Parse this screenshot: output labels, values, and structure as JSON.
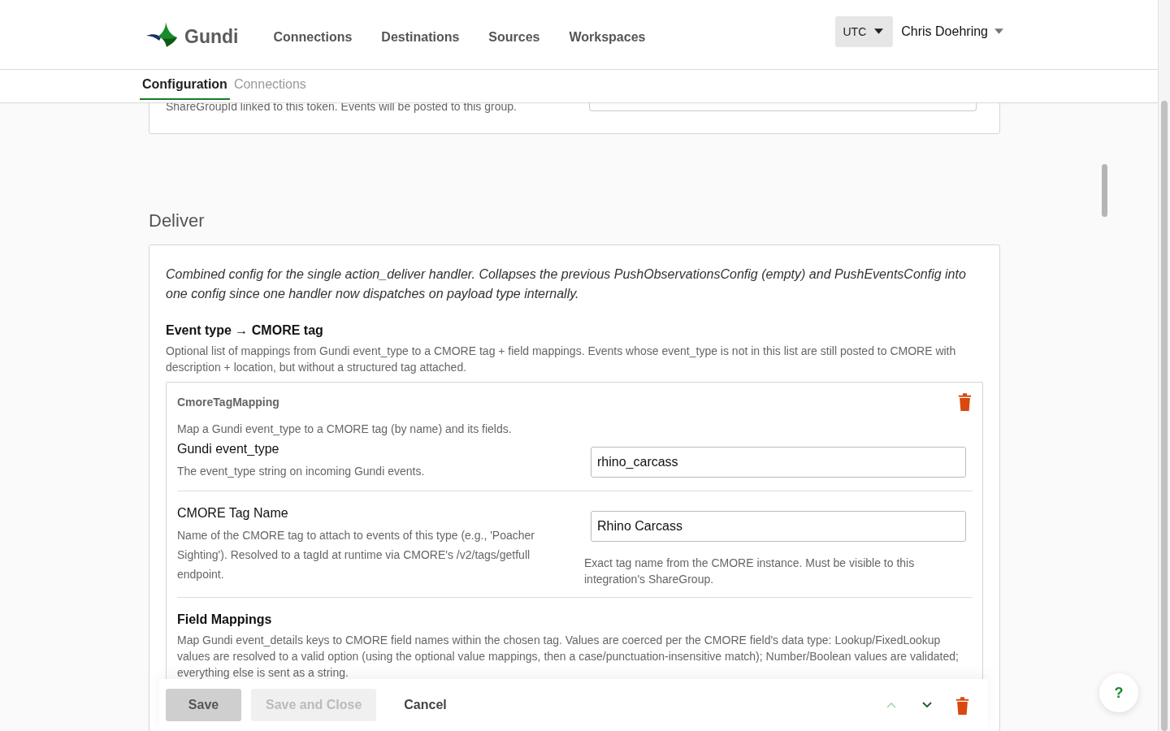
{
  "header": {
    "logo": "Gundi",
    "nav": [
      {
        "label": "Connections"
      },
      {
        "label": "Destinations"
      },
      {
        "label": "Sources"
      },
      {
        "label": "Workspaces"
      }
    ],
    "timezone": "UTC",
    "user": "Chris Doehring"
  },
  "tabs": [
    {
      "label": "Configuration",
      "selected": true
    },
    {
      "label": "Connections",
      "selected": false
    }
  ],
  "top_card": {
    "description": "ShareGroupId linked to this token. Events will be posted to this group."
  },
  "section": {
    "title": "Deliver",
    "description": "Combined config for the single action_deliver handler. Collapses the previous PushObservationsConfig (empty) and PushEventsConfig into one config since one handler now dispatches on payload type internally.",
    "list": {
      "title": "Event type → CMORE tag",
      "description": "Optional list of mappings from Gundi event_type to a CMORE tag + field mappings. Events whose event_type is not in this list are still posted to CMORE with description + location, but without a structured tag attached.",
      "items": [
        {
          "type_label": "CmoreTagMapping",
          "description": "Map a Gundi event_type to a CMORE tag (by name) and its fields.",
          "fields": [
            {
              "label": "Gundi event_type",
              "description": "The event_type string on incoming Gundi events.",
              "value": "rhino_carcass"
            },
            {
              "label": "CMORE Tag Name",
              "description": "Name of the CMORE tag to attach to events of this type (e.g., 'Poacher Sighting'). Resolved to a tagId at runtime via CMORE's /v2/tags/getfull endpoint.",
              "value": "Rhino Carcass",
              "help": "Exact tag name from the CMORE instance. Must be visible to this integration's ShareGroup."
            }
          ],
          "subsection": {
            "title": "Field Mappings",
            "description": "Map Gundi event_details keys to CMORE field names within the chosen tag. Values are coerced per the CMORE field's data type: Lookup/FixedLookup values are resolved to a valid option (using the optional value mappings, then a case/punctuation-insensitive match); Number/Boolean values are validated; everything else is sent as a string."
          }
        }
      ]
    }
  },
  "actions": {
    "buttons": [
      {
        "kind": "primary",
        "label": "Save",
        "disabled": false
      },
      {
        "kind": "secondary",
        "label": "Save and Close",
        "disabled": true
      },
      {
        "kind": "text",
        "label": "Cancel",
        "disabled": false
      }
    ],
    "move_up": {
      "disabled": true
    },
    "move_down": {
      "disabled": false
    }
  },
  "help_button": {
    "label": "?"
  }
}
